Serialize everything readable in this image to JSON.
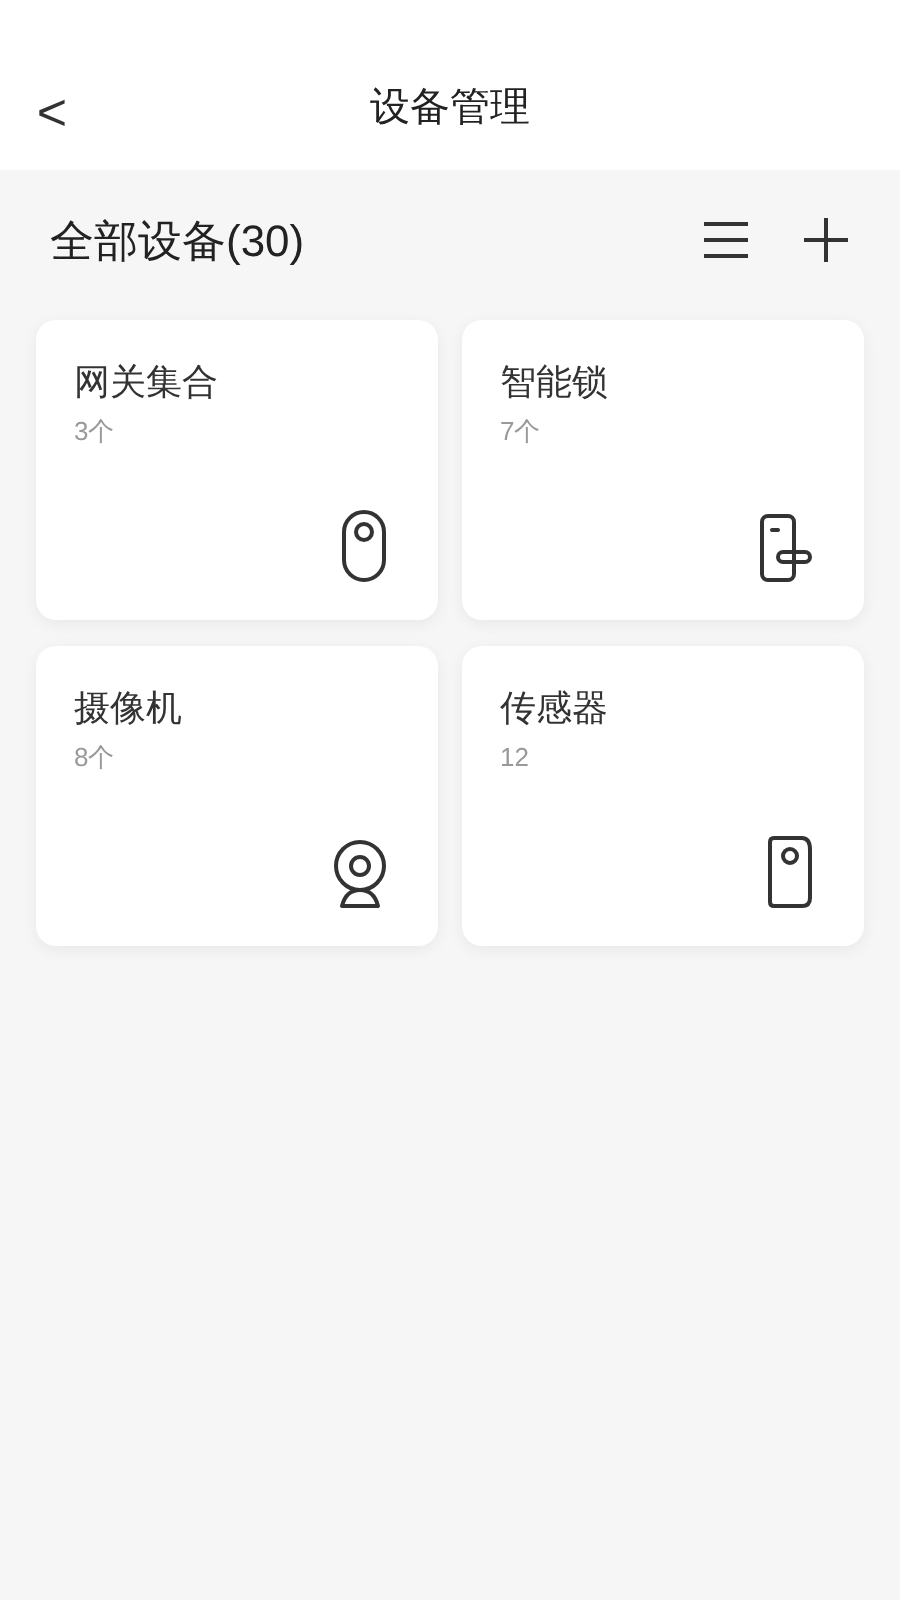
{
  "header": {
    "back": "<",
    "title": "设备管理"
  },
  "summary": {
    "title": "全部设备(30)"
  },
  "devices": [
    {
      "kind": "gateway",
      "name": "网关集合",
      "count": "3个"
    },
    {
      "kind": "lock",
      "name": "智能锁",
      "count": "7个"
    },
    {
      "kind": "camera",
      "name": "摄像机",
      "count": "8个"
    },
    {
      "kind": "sensor",
      "name": "传感器",
      "count": "12"
    }
  ]
}
